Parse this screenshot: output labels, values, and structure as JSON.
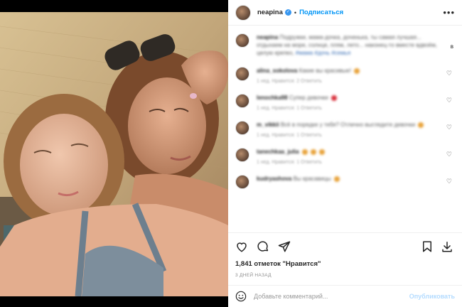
{
  "post": {
    "username": "neapina",
    "follow_label": "Подписаться",
    "more_label": "•••",
    "separator": "•"
  },
  "caption": {
    "username": "neapina",
    "text": "Подружки, мама-дочка, доченька, ты самая лучшая... отдыхаем на море, солнце, пляж, лето... наконец-то вместе вдвоём, целую крепко,",
    "tags": "#мама #дочь #семья",
    "mark": "в"
  },
  "comments": [
    {
      "username": "alina_sokolova",
      "text": "Какие вы красивые!",
      "meta": "1 нед.   Нравится: 2   Ответить",
      "emoji": "yellow"
    },
    {
      "username": "lenochka98",
      "text": "Супер девочки",
      "meta": "1 нед.   Нравится: 1   Ответить",
      "emoji": "red"
    },
    {
      "username": "m_vikkii",
      "text": "Всё в порядке у тебя? Отлично выглядите девочки",
      "meta": "1 нед.   Нравится: 1   Ответить",
      "emoji": "yellow"
    },
    {
      "username": "tanechkaa_julia",
      "text": "",
      "meta": "1 нед.   Нравится: 1   Ответить",
      "emoji": "yellow"
    },
    {
      "username": "kudryashova",
      "text": "Вы красавицы",
      "meta": "",
      "emoji": "yellow"
    }
  ],
  "stats": {
    "likes": "1,841 отметок \"Нравится\"",
    "time": "3 ДНЕЙ НАЗАД"
  },
  "composer": {
    "placeholder": "Добавьте комментарий...",
    "publish_label": "Опубликовать"
  },
  "icons": [
    "like-icon",
    "comment-icon",
    "share-icon",
    "save-icon",
    "download-icon",
    "smiley-icon",
    "more-icon",
    "verified-icon"
  ],
  "colors": {
    "accent": "#0095f6",
    "publish_disabled": "#b3dbff",
    "text": "#262626",
    "muted": "#8e8e8e"
  }
}
